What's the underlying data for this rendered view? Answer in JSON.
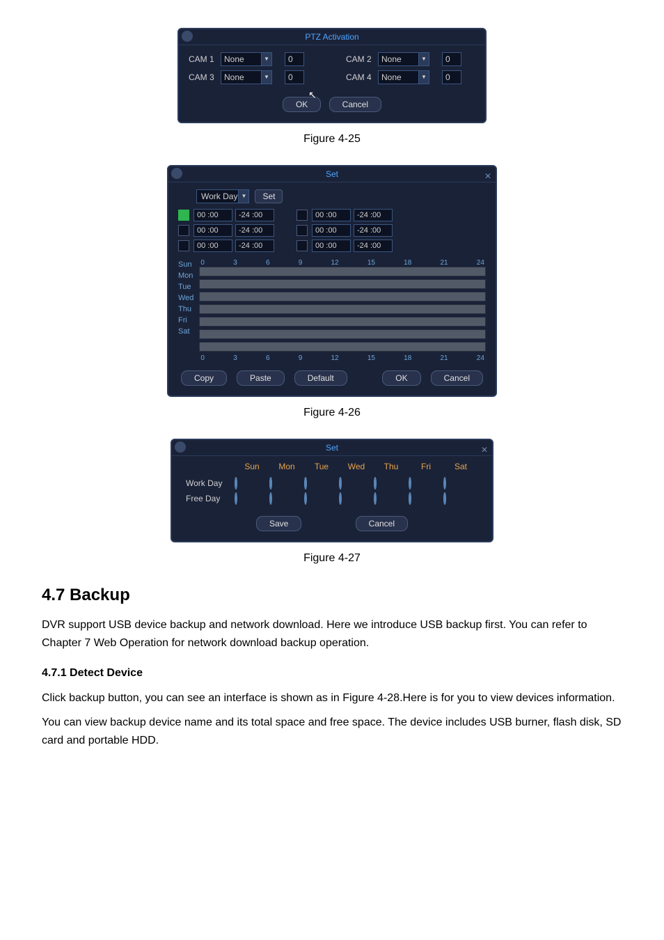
{
  "fig1": {
    "title": "PTZ Activation",
    "rows": [
      {
        "camA": "CAM 1",
        "valA": "None",
        "numA": "0",
        "camB": "CAM 2",
        "valB": "None",
        "numB": "0"
      },
      {
        "camA": "CAM 3",
        "valA": "None",
        "numA": "0",
        "camB": "CAM 4",
        "valB": "None",
        "numB": "0"
      }
    ],
    "ok": "OK",
    "cancel": "Cancel",
    "caption": "Figure 4-25"
  },
  "fig2": {
    "title": "Set",
    "sel_label": "Work Day",
    "set_btn": "Set",
    "time_rows": [
      {
        "on": true,
        "l1": "00 :00",
        "l2": "-24 :00",
        "r1": "00 :00",
        "r2": "-24 :00"
      },
      {
        "on": false,
        "l1": "00 :00",
        "l2": "-24 :00",
        "r1": "00 :00",
        "r2": "-24 :00"
      },
      {
        "on": false,
        "l1": "00 :00",
        "l2": "-24 :00",
        "r1": "00 :00",
        "r2": "-24 :00"
      }
    ],
    "days": [
      "Sun",
      "Mon",
      "Tue",
      "Wed",
      "Thu",
      "Fri",
      "Sat"
    ],
    "axis": [
      "0",
      "3",
      "6",
      "9",
      "12",
      "15",
      "18",
      "21",
      "24"
    ],
    "btns": {
      "copy": "Copy",
      "paste": "Paste",
      "default": "Default",
      "ok": "OK",
      "cancel": "Cancel"
    },
    "caption": "Figure 4-26"
  },
  "fig3": {
    "title": "Set",
    "cols": [
      "Sun",
      "Mon",
      "Tue",
      "Wed",
      "Thu",
      "Fri",
      "Sat"
    ],
    "rows": [
      {
        "label": "Work Day",
        "vals": [
          true,
          true,
          true,
          true,
          true,
          false,
          false
        ]
      },
      {
        "label": "Free Day",
        "vals": [
          false,
          false,
          false,
          false,
          false,
          true,
          true
        ]
      }
    ],
    "save": "Save",
    "cancel": "Cancel",
    "caption": "Figure 4-27"
  },
  "section": {
    "heading": "4.7  Backup",
    "p1": "DVR support USB device backup and network download. Here we introduce USB backup first. You can refer to Chapter 7 Web Operation for network download backup operation.",
    "sub": "4.7.1 Detect Device",
    "p2": "Click backup button, you can see an interface is shown as in Figure 4-28.Here is for you to view devices information.",
    "p3": "You can view backup device name and its total space and free space. The device includes USB burner, flash disk, SD card and portable HDD."
  }
}
